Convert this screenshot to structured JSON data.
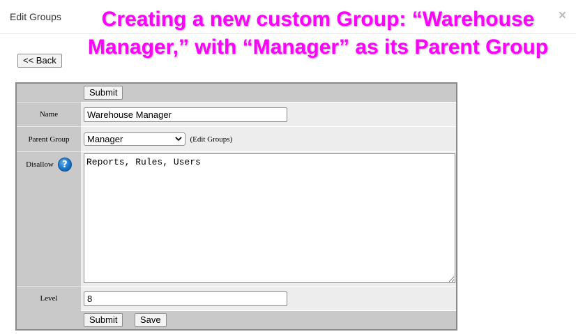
{
  "dialog": {
    "title": "Edit Groups",
    "close_label": "×"
  },
  "caption": {
    "line1": "Creating a new custom Group: “Warehouse",
    "line2": "Manager,” with “Manager” as its Parent Group"
  },
  "back_button": "<< Back",
  "form": {
    "submit_label": "Submit",
    "save_label": "Save",
    "name": {
      "label": "Name",
      "value": "Warehouse Manager"
    },
    "parent_group": {
      "label": "Parent Group",
      "selected": "Manager",
      "link": "(Edit Groups)"
    },
    "disallow": {
      "label": "Disallow",
      "value": "Reports, Rules, Users",
      "help_icon": "question-help-icon"
    },
    "level": {
      "label": "Level",
      "value": "8"
    }
  },
  "colors": {
    "caption": "#ff00ff",
    "label_bg": "#c9c9c9",
    "cell_bg": "#ededed",
    "help_icon": "#1a74c9"
  }
}
